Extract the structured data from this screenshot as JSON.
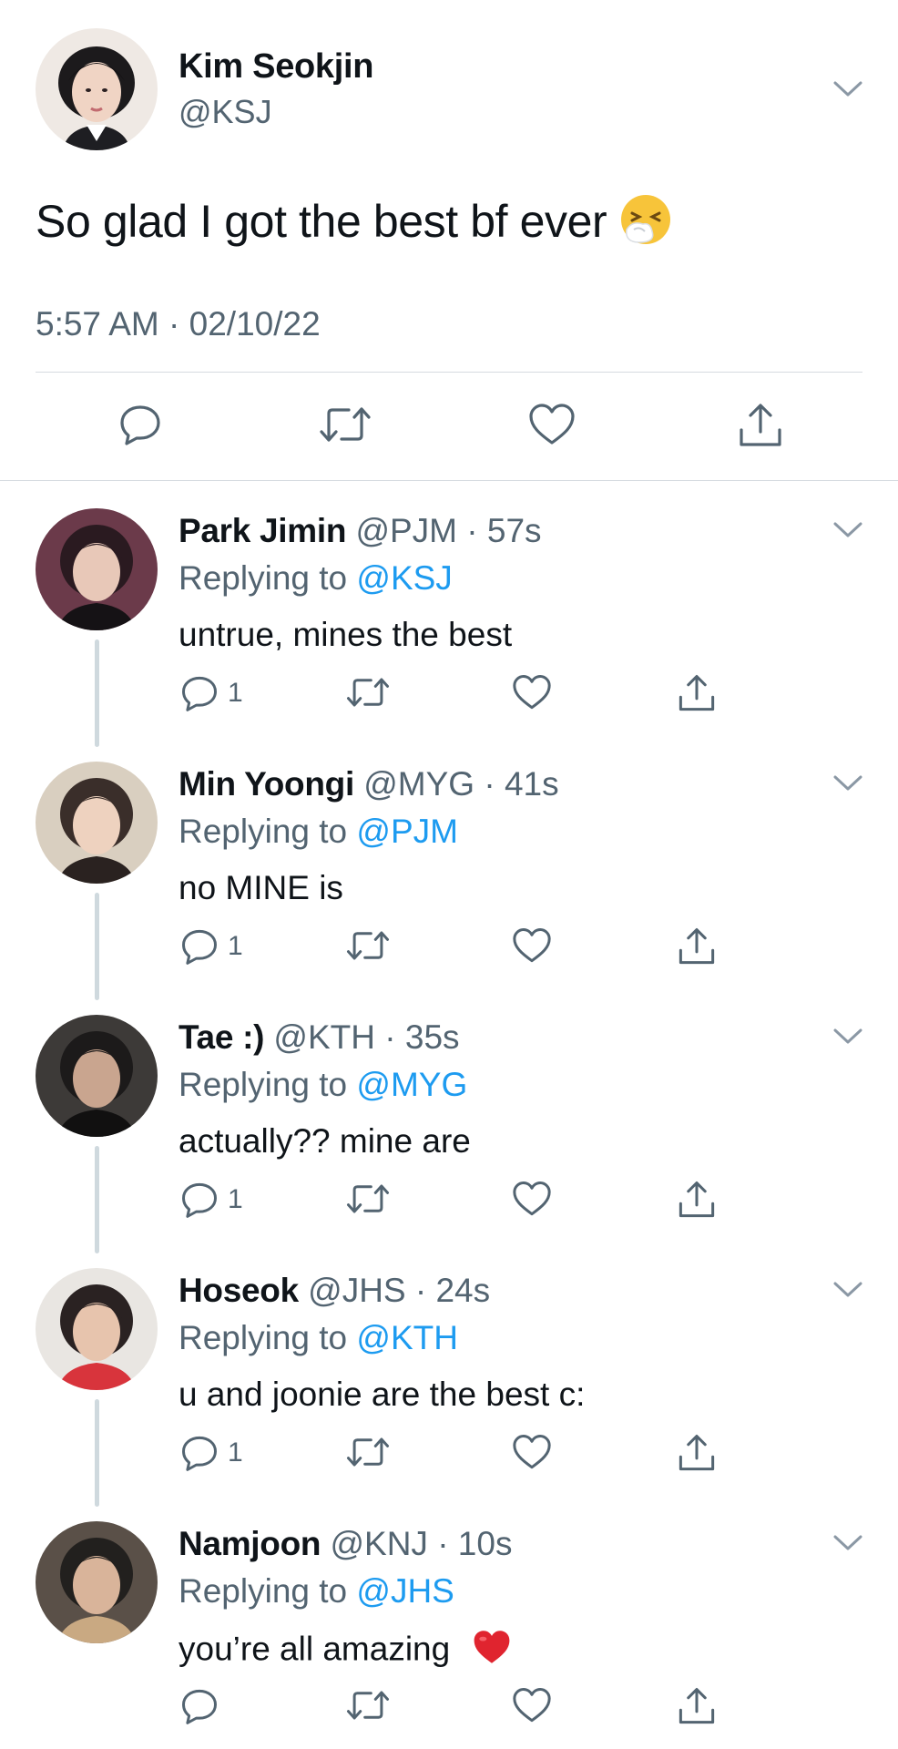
{
  "main_tweet": {
    "name": "Kim Seokjin",
    "handle": "@KSJ",
    "text": "So glad I got the best bf ever",
    "emoji": "sneezing-face",
    "timestamp": "5:57 AM · 02/10/22"
  },
  "replies": [
    {
      "name": "Park Jimin",
      "meta": "@PJM · 57s",
      "replying_prefix": "Replying to ",
      "replying_to": "@KSJ",
      "text": "untrue, mines the best",
      "reply_count": "1"
    },
    {
      "name": "Min Yoongi",
      "meta": "@MYG · 41s",
      "replying_prefix": "Replying to ",
      "replying_to": "@PJM",
      "text": "no MINE is",
      "reply_count": "1"
    },
    {
      "name": "Tae :)",
      "meta": "@KTH · 35s",
      "replying_prefix": "Replying to ",
      "replying_to": "@MYG",
      "text": "actually?? mine are",
      "reply_count": "1"
    },
    {
      "name": "Hoseok",
      "meta": "@JHS · 24s",
      "replying_prefix": "Replying to ",
      "replying_to": "@KTH",
      "text": "u and joonie are the best c:",
      "reply_count": "1"
    },
    {
      "name": "Namjoon",
      "meta": "@KNJ · 10s",
      "replying_prefix": "Replying to ",
      "replying_to": "@JHS",
      "text": "you’re all amazing",
      "emoji": "red-heart",
      "reply_count": ""
    }
  ],
  "colors": {
    "link": "#1d9bf0",
    "secondary_text": "#536471",
    "icon": "#536471",
    "divider": "#d6dbe0",
    "thread_line": "#cfd9de"
  },
  "icons": {
    "reply": "reply-icon",
    "retweet": "retweet-icon",
    "like": "heart-icon",
    "share": "share-icon",
    "more": "chevron-down-icon"
  }
}
